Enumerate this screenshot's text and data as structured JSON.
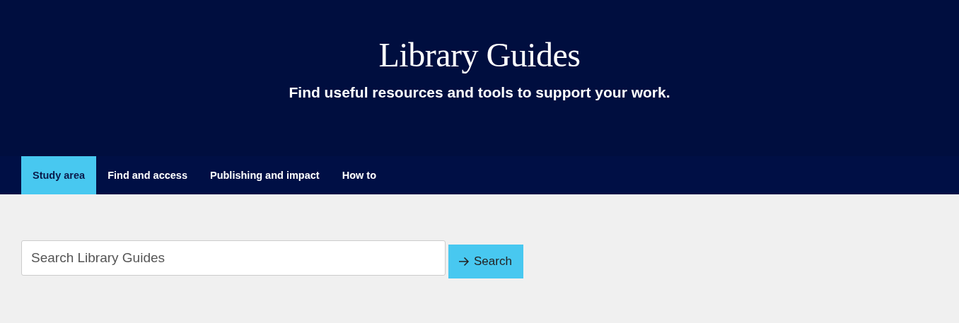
{
  "header": {
    "title": "Library Guides",
    "subtitle": "Find useful resources and tools to support your work."
  },
  "tabs": [
    {
      "label": "Study area",
      "selected": true
    },
    {
      "label": "Find and access",
      "selected": false
    },
    {
      "label": "Publishing and impact",
      "selected": false
    },
    {
      "label": "How to",
      "selected": false
    }
  ],
  "search": {
    "placeholder": "Search Library Guides",
    "button": "Search"
  }
}
